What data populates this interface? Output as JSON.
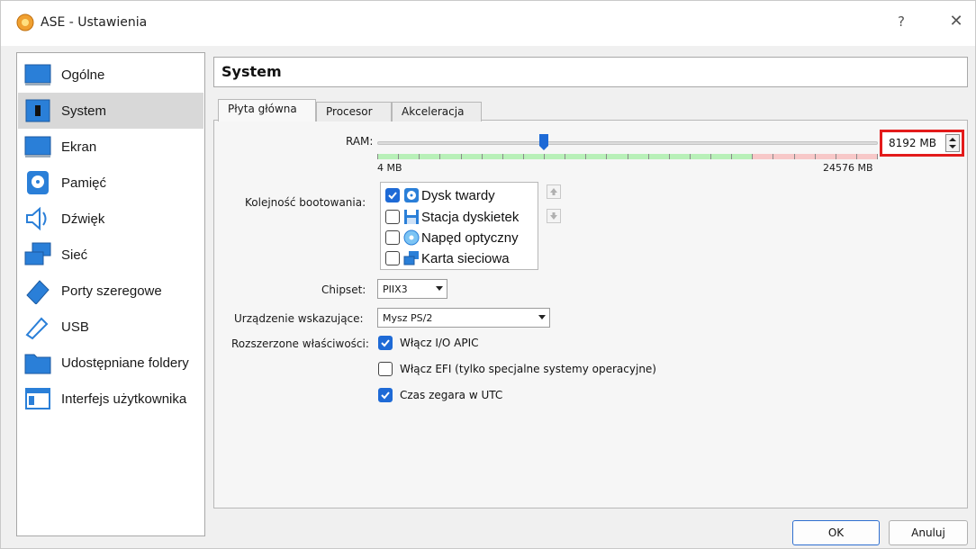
{
  "window": {
    "title": "ASE - Ustawienia",
    "help_glyph": "?",
    "close_glyph": "✕"
  },
  "sidebar": {
    "items": [
      {
        "label": "Ogólne",
        "icon": "monitor-icon"
      },
      {
        "label": "System",
        "icon": "chip-icon",
        "selected": true
      },
      {
        "label": "Ekran",
        "icon": "display-icon"
      },
      {
        "label": "Pamięć",
        "icon": "storage-icon"
      },
      {
        "label": "Dźwięk",
        "icon": "speaker-icon"
      },
      {
        "label": "Sieć",
        "icon": "network-icon"
      },
      {
        "label": "Porty szeregowe",
        "icon": "serial-port-icon"
      },
      {
        "label": "USB",
        "icon": "usb-icon"
      },
      {
        "label": "Udostępniane foldery",
        "icon": "folder-icon"
      },
      {
        "label": "Interfejs użytkownika",
        "icon": "ui-window-icon"
      }
    ]
  },
  "panel": {
    "title": "System"
  },
  "tabs": [
    {
      "label": "Płyta główna",
      "active": true
    },
    {
      "label": "Procesor"
    },
    {
      "label": "Akceleracja"
    }
  ],
  "motherboard": {
    "ram": {
      "label": "RAM:",
      "min_label": "4 MB",
      "max_label": "24576 MB",
      "value": "8192 MB",
      "value_mb": 8192,
      "max_mb": 24576,
      "recommended_fraction": 0.75
    },
    "boot_order": {
      "label": "Kolejność bootowania:",
      "items": [
        {
          "label": "Dysk twardy",
          "checked": true,
          "icon": "hard-disk-icon"
        },
        {
          "label": "Stacja dyskietek",
          "checked": false,
          "icon": "floppy-icon"
        },
        {
          "label": "Napęd optyczny",
          "checked": false,
          "icon": "optical-disc-icon"
        },
        {
          "label": "Karta sieciowa",
          "checked": false,
          "icon": "network-card-icon"
        }
      ]
    },
    "chipset": {
      "label": "Chipset:",
      "value": "PIIX3"
    },
    "pointing_device": {
      "label": "Urządzenie wskazujące:",
      "value": "Mysz PS/2"
    },
    "extended": {
      "label": "Rozszerzone właściwości:",
      "options": [
        {
          "label": "Włącz I/O APIC",
          "checked": true
        },
        {
          "label": "Włącz EFI (tylko specjalne systemy operacyjne)",
          "checked": false
        },
        {
          "label": "Czas zegara w UTC",
          "checked": true
        }
      ]
    }
  },
  "buttons": {
    "ok": "OK",
    "cancel": "Anuluj"
  },
  "colors": {
    "accent": "#1e6ad6",
    "highlight_box": "#e31b1b",
    "green_zone": "#b8f0b8",
    "red_zone": "#f7c8c8"
  }
}
